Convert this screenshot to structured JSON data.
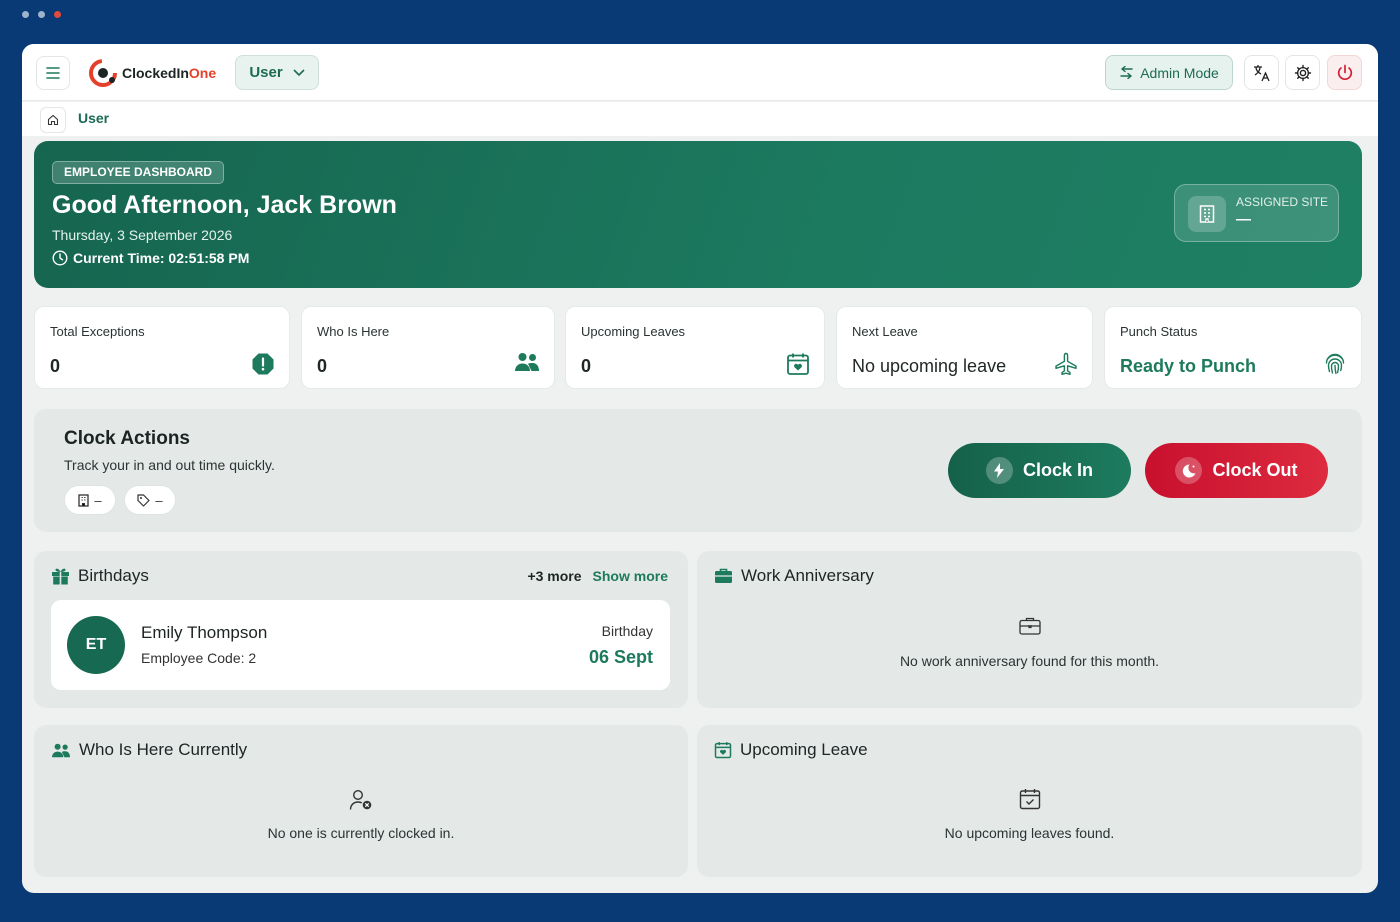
{
  "colors": {
    "brand_green": "#1d7a5c",
    "danger_red": "#d41f36",
    "accent_orange": "#e5402b",
    "frame_blue": "#0a3a75"
  },
  "topbar": {
    "logo_name": "ClockedIn",
    "logo_accent": "One",
    "role_label": "User",
    "admin_label": "Admin Mode",
    "icons": [
      "menu-icon",
      "translate-icon",
      "gear-icon",
      "power-icon"
    ]
  },
  "breadcrumb": {
    "current": "User"
  },
  "hero": {
    "badge": "EMPLOYEE DASHBOARD",
    "greeting": "Good Afternoon, Jack Brown",
    "date": "Thursday, 3 September 2026",
    "time": "Current Time: 02:51:58 PM",
    "site_label": "ASSIGNED SITE",
    "site_value": "—"
  },
  "stats": [
    {
      "label": "Total Exceptions",
      "value": "0",
      "icon": "alert-icon"
    },
    {
      "label": "Who Is Here",
      "value": "0",
      "icon": "people-icon"
    },
    {
      "label": "Upcoming Leaves",
      "value": "0",
      "icon": "calendar-heart-icon"
    },
    {
      "label": "Next Leave",
      "value": "No upcoming leave",
      "icon": "plane-icon"
    },
    {
      "label": "Punch Status",
      "value": "Ready to Punch",
      "icon": "fingerprint-icon"
    }
  ],
  "clock": {
    "title": "Clock Actions",
    "subtitle": "Track your in and out time quickly.",
    "site_chip": "–",
    "tag_chip": "–",
    "clock_in": "Clock In",
    "clock_out": "Clock Out"
  },
  "birthdays": {
    "title": "Birthdays",
    "more_count": "+3 more",
    "show_more": "Show more",
    "person": {
      "initials": "ET",
      "name": "Emily Thompson",
      "code": "Employee Code: 2",
      "kind": "Birthday",
      "date": "06 Sept"
    }
  },
  "anniversary": {
    "title": "Work Anniversary",
    "empty": "No work anniversary found for this month."
  },
  "who_here": {
    "title": "Who Is Here Currently",
    "empty": "No one is currently clocked in."
  },
  "upcoming_leave": {
    "title": "Upcoming Leave",
    "empty": "No upcoming leaves found."
  }
}
